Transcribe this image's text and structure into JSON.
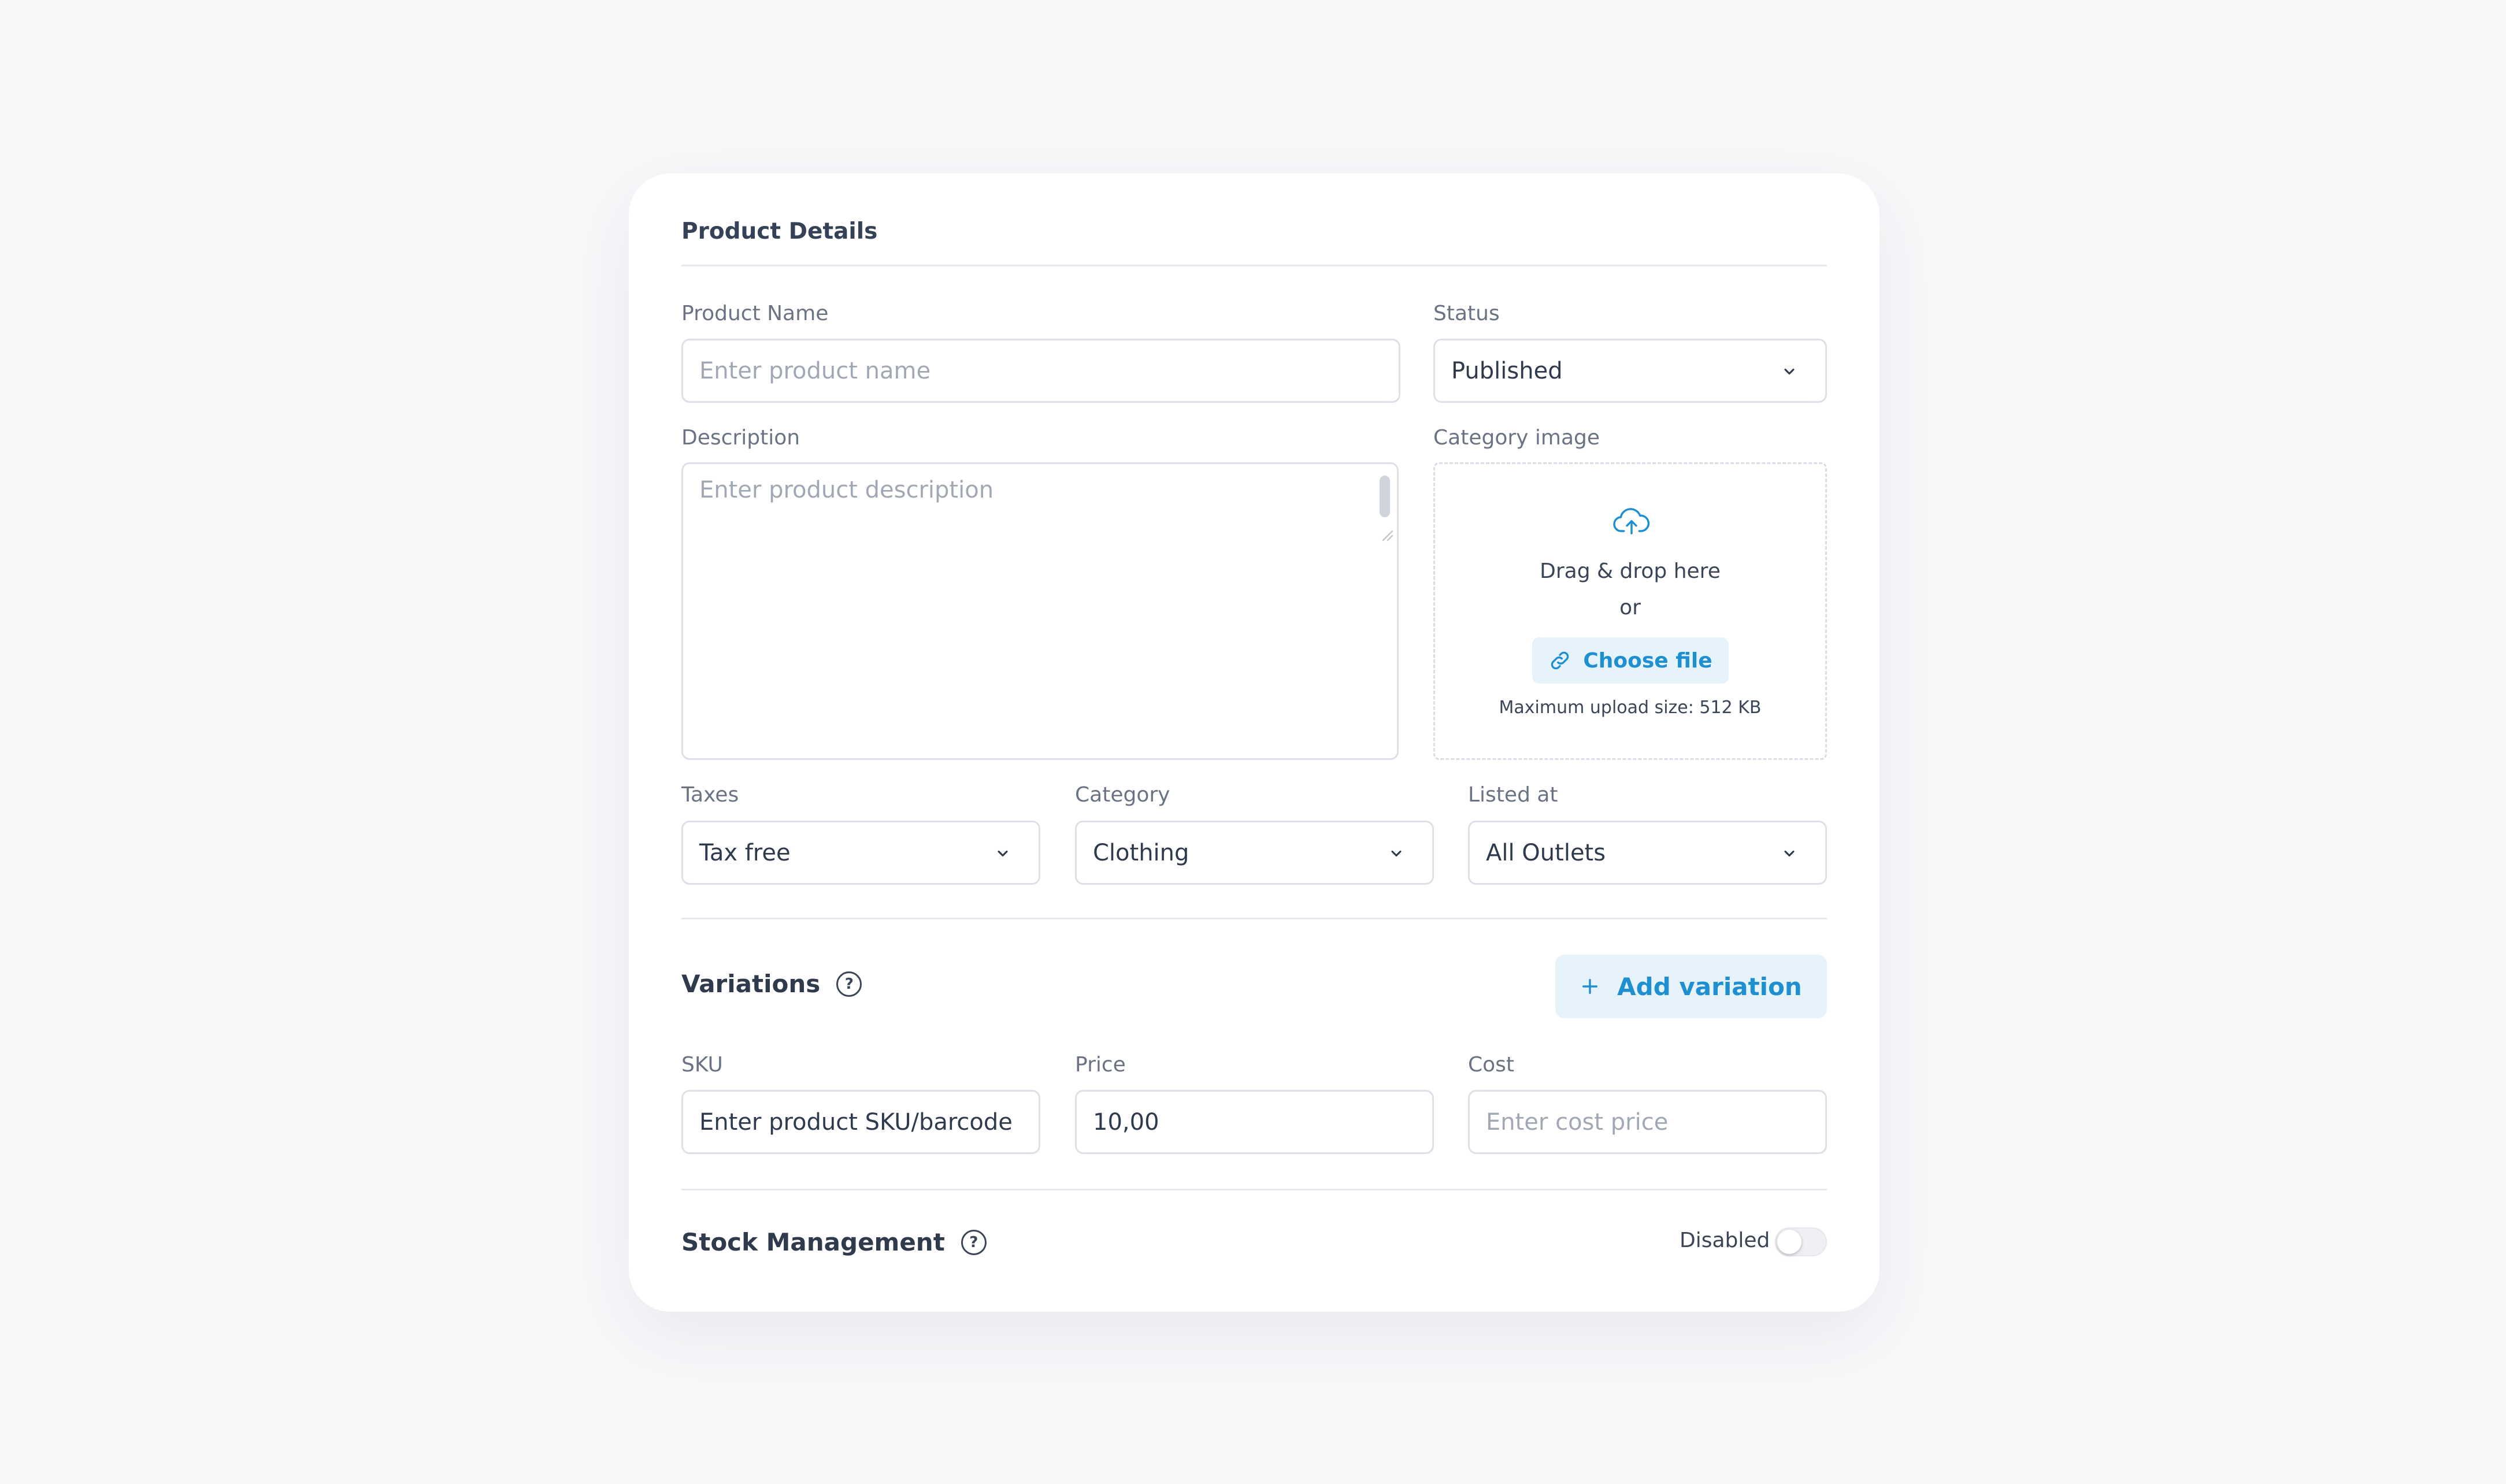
{
  "card": {
    "title": "Product Details"
  },
  "product_name": {
    "label": "Product Name",
    "placeholder": "Enter product name",
    "value": ""
  },
  "status": {
    "label": "Status",
    "value": "Published"
  },
  "description": {
    "label": "Description",
    "placeholder": "Enter product description",
    "value": ""
  },
  "category_image": {
    "label": "Category image",
    "upload_icon": "cloud-upload-icon",
    "drag_text": "Drag & drop here",
    "or_text": "or",
    "choose_label": "Choose file",
    "choose_icon": "link-icon",
    "max_size": "Maximum upload size: 512 KB"
  },
  "taxes": {
    "label": "Taxes",
    "value": "Tax free"
  },
  "category": {
    "label": "Category",
    "value": "Clothing"
  },
  "listed_at": {
    "label": "Listed at",
    "value": "All Outlets"
  },
  "variations": {
    "title": "Variations",
    "help_icon": "help-circle-icon",
    "add_label": "Add variation",
    "add_icon": "plus-icon"
  },
  "sku": {
    "label": "SKU",
    "value": "Enter product SKU/barcode"
  },
  "price": {
    "label": "Price",
    "value": "10,00"
  },
  "cost": {
    "label": "Cost",
    "placeholder": "Enter cost price",
    "value": ""
  },
  "stock": {
    "title": "Stock Management",
    "help_icon": "help-circle-icon",
    "toggle_label": "Disabled",
    "toggle_on": false
  },
  "colors": {
    "accent": "#1e8fd0",
    "accent_bg": "#e6f3fb",
    "text": "#2f3a4d",
    "border": "#dde1e7"
  }
}
